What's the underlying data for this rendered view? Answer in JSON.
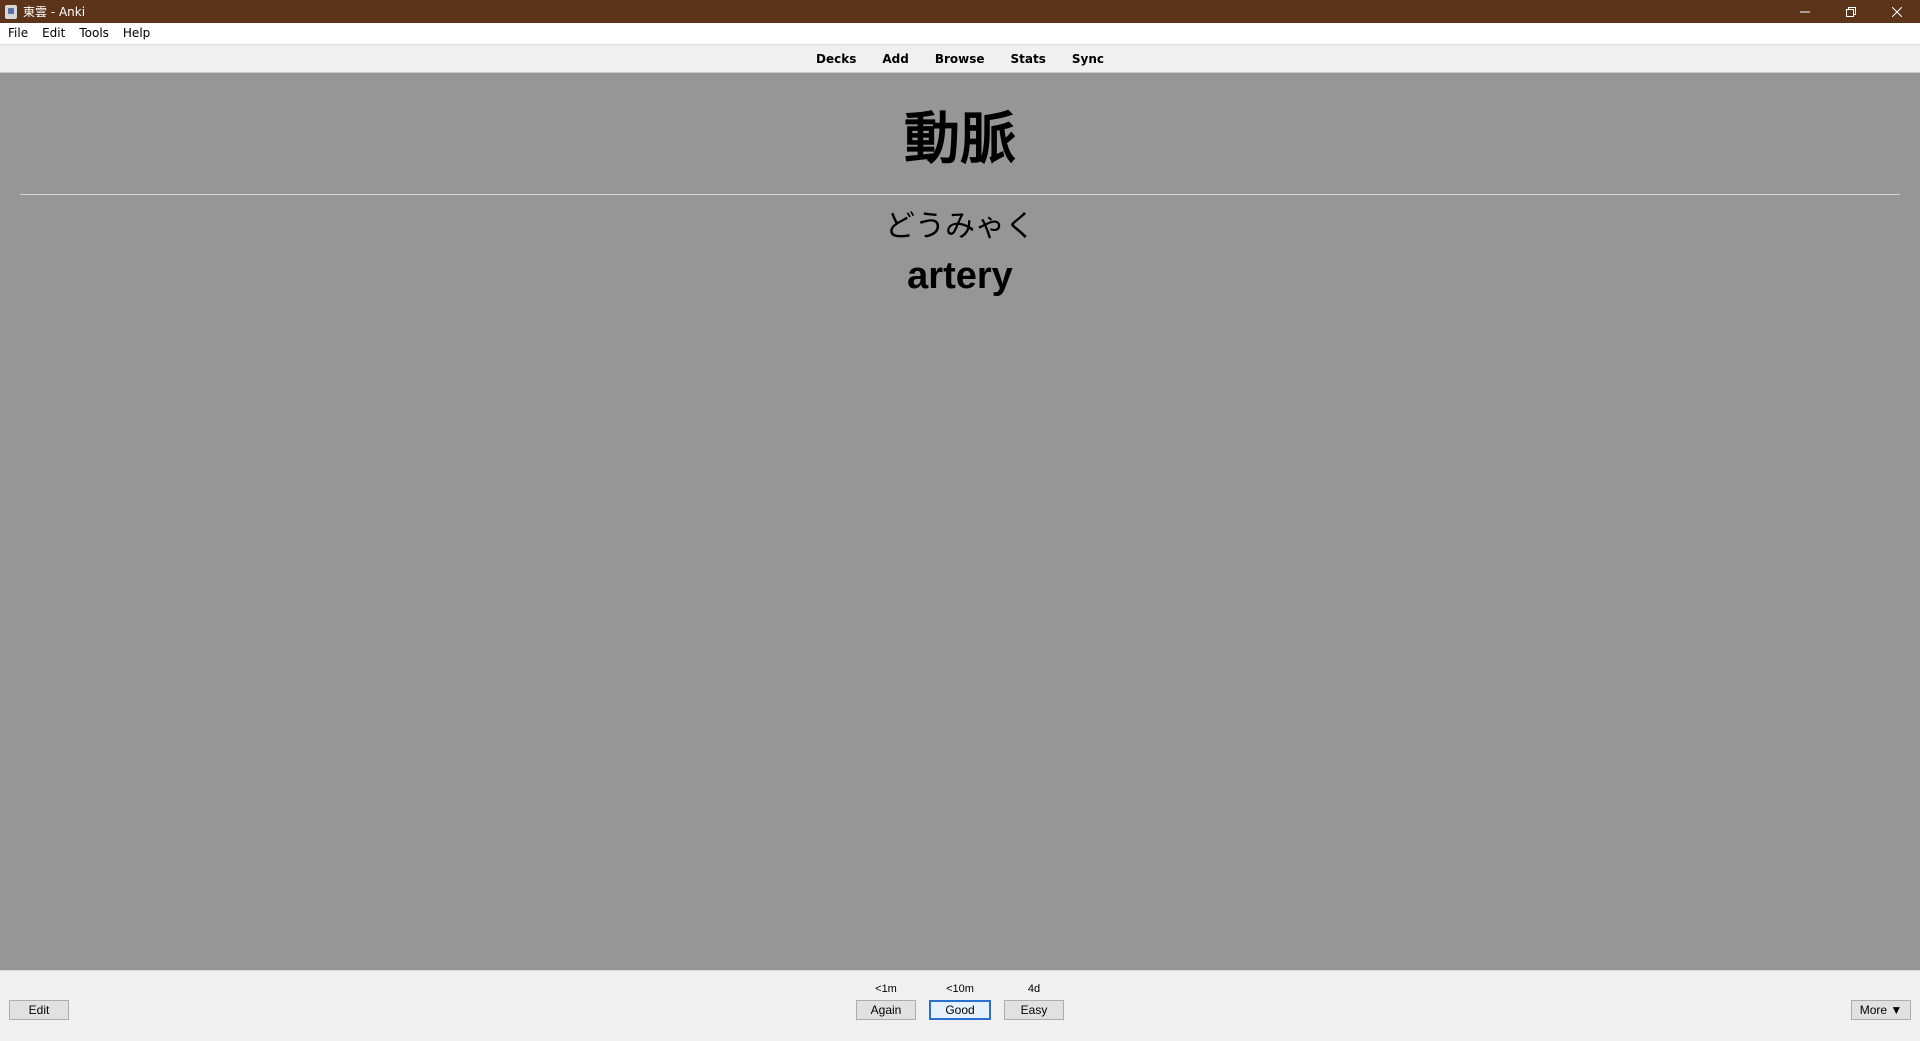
{
  "window": {
    "title": "東雲 - Anki",
    "controls": {
      "minimize_icon": "minimize-icon",
      "restore_icon": "restore-icon",
      "close_icon": "close-icon"
    }
  },
  "menubar": {
    "items": [
      "File",
      "Edit",
      "Tools",
      "Help"
    ]
  },
  "toolbar": {
    "items": [
      "Decks",
      "Add",
      "Browse",
      "Stats",
      "Sync"
    ]
  },
  "card": {
    "front": "動脈",
    "reading": "どうみゃく",
    "meaning": "artery",
    "background_color": "#969696"
  },
  "bottombar": {
    "edit_label": "Edit",
    "answers": [
      {
        "interval": "<1m",
        "label": "Again"
      },
      {
        "interval": "<10m",
        "label": "Good"
      },
      {
        "interval": "4d",
        "label": "Easy"
      }
    ],
    "more_label": "More ▼"
  },
  "colors": {
    "titlebar": "#5b3419",
    "focus_border": "#2b6fd0"
  }
}
